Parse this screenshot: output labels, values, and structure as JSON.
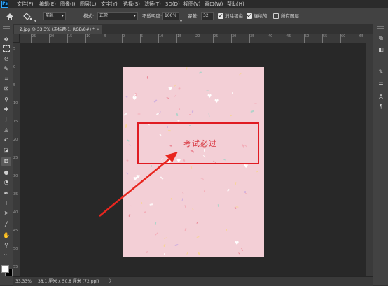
{
  "app": {
    "logo": "Ps"
  },
  "menu": [
    "文件(F)",
    "编辑(E)",
    "图像(I)",
    "图层(L)",
    "文字(Y)",
    "选择(S)",
    "滤镜(T)",
    "3D(D)",
    "视图(V)",
    "窗口(W)",
    "帮助(H)"
  ],
  "options": {
    "home_icon": "home-icon",
    "tool_icon": "paint-bucket-icon",
    "fill_source": "前景",
    "mode_label": "模式:",
    "mode_value": "正常",
    "opacity_label": "不透明度:",
    "opacity_value": "100%",
    "tolerance_label": "容差:",
    "tolerance_value": "32",
    "antialias_label": "消除锯齿",
    "antialias_checked": true,
    "contiguous_label": "连续的",
    "contiguous_checked": true,
    "all_layers_label": "所有图层",
    "all_layers_checked": false
  },
  "document_tab": {
    "title": "2.jpg @ 33.3% (未标题-1, RGB/8#) *",
    "close": "×"
  },
  "ruler": {
    "h_labels": [
      "25",
      "20",
      "15",
      "10",
      "5",
      "0",
      "5",
      "10",
      "15",
      "20",
      "25",
      "30",
      "35",
      "40",
      "45",
      "50",
      "55",
      "60",
      "65",
      "70"
    ],
    "v_labels": [
      "5",
      "0",
      "5",
      "10",
      "15",
      "20",
      "25",
      "30",
      "35",
      "40",
      "45",
      "50",
      "55"
    ]
  },
  "canvas": {
    "text": "考试必过",
    "highlight_color": "#e01b22",
    "arrow_color": "#e8261f",
    "paper_color": "#f3cfd6"
  },
  "statusbar": {
    "zoom": "33.33%",
    "doc_info": "38.1 厘米 x 50.8 厘米 (72 ppi)",
    "arrow": "〉"
  },
  "tools": [
    "move-icon",
    "marquee-icon",
    "lasso-icon",
    "quick-select-icon",
    "crop-icon",
    "frame-icon",
    "eyedropper-icon",
    "healing-icon",
    "brush-icon",
    "stamp-icon",
    "history-brush-icon",
    "eraser-icon",
    "paint-bucket-icon",
    "blur-icon",
    "dodge-icon",
    "pen-icon",
    "type-icon",
    "path-select-icon",
    "shape-icon",
    "hand-icon",
    "zoom-icon",
    "more-icon"
  ]
}
